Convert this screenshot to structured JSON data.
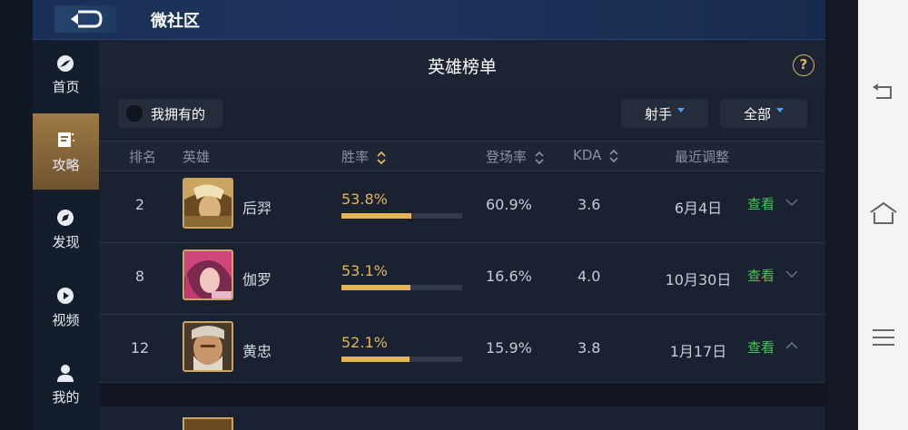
{
  "app": {
    "title": "微社区"
  },
  "sidebar": {
    "items": [
      {
        "label": "首页",
        "icon": "home-compass-icon",
        "active": false
      },
      {
        "label": "攻略",
        "icon": "guide-icon",
        "active": true
      },
      {
        "label": "发现",
        "icon": "discover-compass-icon",
        "active": false
      },
      {
        "label": "视频",
        "icon": "play-icon",
        "active": false
      },
      {
        "label": "我的",
        "icon": "user-icon",
        "active": false
      }
    ]
  },
  "page": {
    "title": "英雄榜单",
    "help": "?"
  },
  "filters": {
    "owned_label": "我拥有的",
    "role": "射手",
    "scope": "全部"
  },
  "table": {
    "headers": {
      "rank": "排名",
      "hero": "英雄",
      "winrate": "胜率",
      "appear": "登场率",
      "kda": "KDA",
      "update": "最近调整"
    },
    "rows": [
      {
        "rank": "2",
        "hero": "后羿",
        "winrate": "53.8%",
        "winrate_value": 0.538,
        "appear": "60.9%",
        "kda": "3.6",
        "date": "6月4日",
        "action": "查看",
        "expanded": false
      },
      {
        "rank": "8",
        "hero": "伽罗",
        "winrate": "53.1%",
        "winrate_value": 0.531,
        "appear": "16.6%",
        "kda": "4.0",
        "date": "10月30日",
        "action": "查看",
        "expanded": false
      },
      {
        "rank": "12",
        "hero": "黄忠",
        "winrate": "52.1%",
        "winrate_value": 0.521,
        "appear": "15.9%",
        "kda": "3.8",
        "date": "1月17日",
        "action": "查看",
        "expanded": true
      }
    ]
  },
  "colors": {
    "accent_gold": "#e3b653",
    "view_green": "#49c25a",
    "caret_blue": "#4ea2f5"
  }
}
